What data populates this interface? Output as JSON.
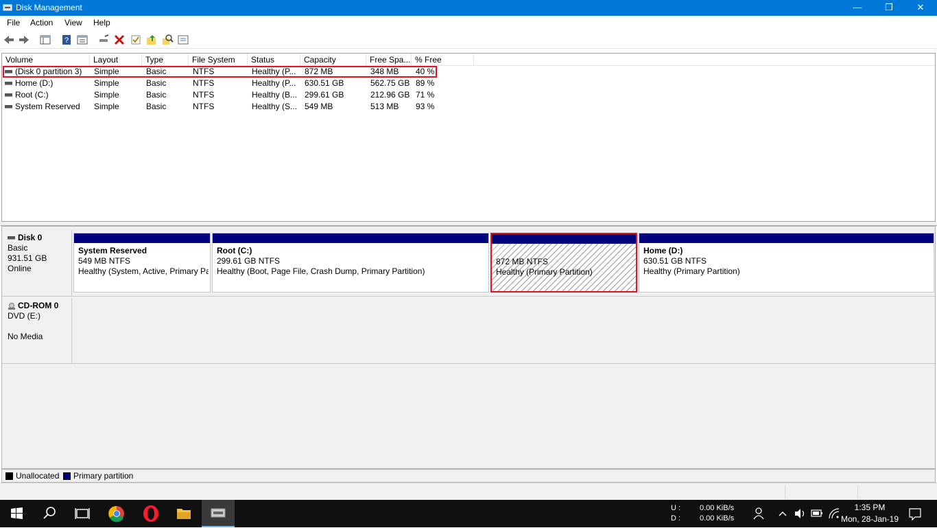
{
  "window": {
    "title": "Disk Management"
  },
  "menu": [
    "File",
    "Action",
    "View",
    "Help"
  ],
  "toolbar": [
    "back-icon",
    "forward-icon",
    "console-tree-icon",
    "help-icon",
    "properties-icon",
    "connect-icon",
    "delete-icon",
    "check-icon",
    "export-icon",
    "search-icon",
    "settings-icon"
  ],
  "volume_table": {
    "columns": [
      "Volume",
      "Layout",
      "Type",
      "File System",
      "Status",
      "Capacity",
      "Free Spa...",
      "% Free"
    ],
    "rows": [
      [
        "(Disk 0 partition 3)",
        "Simple",
        "Basic",
        "NTFS",
        "Healthy (P...",
        "872 MB",
        "348 MB",
        "40 %"
      ],
      [
        "Home (D:)",
        "Simple",
        "Basic",
        "NTFS",
        "Healthy (P...",
        "630.51 GB",
        "562.75 GB",
        "89 %"
      ],
      [
        "Root (C:)",
        "Simple",
        "Basic",
        "NTFS",
        "Healthy (B...",
        "299.61 GB",
        "212.96 GB",
        "71 %"
      ],
      [
        "System Reserved",
        "Simple",
        "Basic",
        "NTFS",
        "Healthy (S...",
        "549 MB",
        "513 MB",
        "93 %"
      ]
    ]
  },
  "disks": {
    "disk0": {
      "name": "Disk 0",
      "type": "Basic",
      "size": "931.51 GB",
      "state": "Online"
    },
    "cdrom0": {
      "name": "CD-ROM 0",
      "type": "DVD (E:)",
      "state": "No Media"
    }
  },
  "partitions": [
    {
      "name": "System Reserved",
      "size": "549 MB NTFS",
      "status": "Healthy (System, Active, Primary Partition)"
    },
    {
      "name": "Root  (C:)",
      "size": "299.61 GB NTFS",
      "status": "Healthy (Boot, Page File, Crash Dump, Primary Partition)"
    },
    {
      "name": "",
      "size": "872 MB NTFS",
      "status": "Healthy (Primary Partition)"
    },
    {
      "name": "Home  (D:)",
      "size": "630.51 GB NTFS",
      "status": "Healthy (Primary Partition)"
    }
  ],
  "legend": {
    "unallocated": "Unallocated",
    "primary": "Primary partition",
    "unallocated_color": "#000000",
    "primary_color": "#00007f"
  },
  "taskbar": {
    "net_u_label": "U :",
    "net_u_value": "0.00 KiB/s",
    "net_d_label": "D :",
    "net_d_value": "0.00 KiB/s",
    "time": "1:35 PM",
    "date": "Mon, 28-Jan-19"
  },
  "colors": {
    "titlebar": "#0078d7",
    "highlight": "#e81123",
    "partition_bar": "#00007f"
  }
}
